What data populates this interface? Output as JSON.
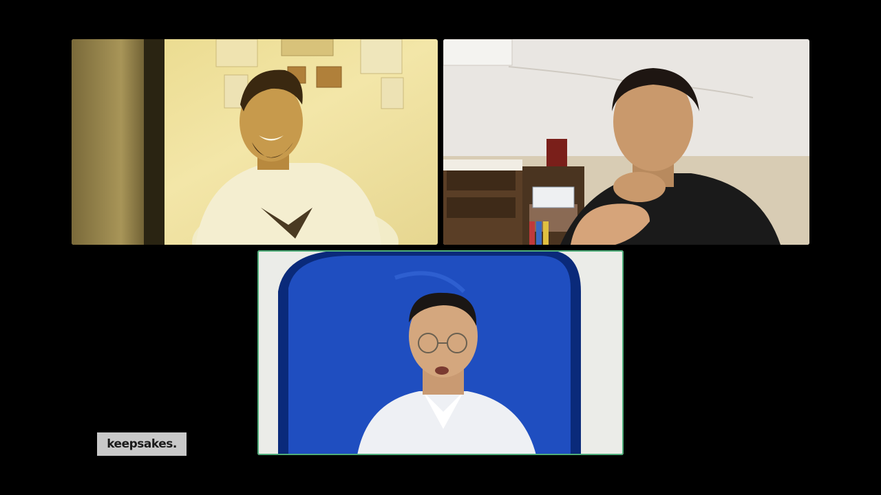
{
  "brand": {
    "logo_text": "keepsakes."
  },
  "colors": {
    "background": "#000000",
    "active_speaker_border": "#4fae7a",
    "logo_badge_bg": "#c9c9c9"
  },
  "participants": [
    {
      "id": "top-left",
      "name": "",
      "is_active_speaker": false
    },
    {
      "id": "top-right",
      "name": "",
      "is_active_speaker": false
    },
    {
      "id": "bottom-center",
      "name": "",
      "is_active_speaker": true
    }
  ]
}
